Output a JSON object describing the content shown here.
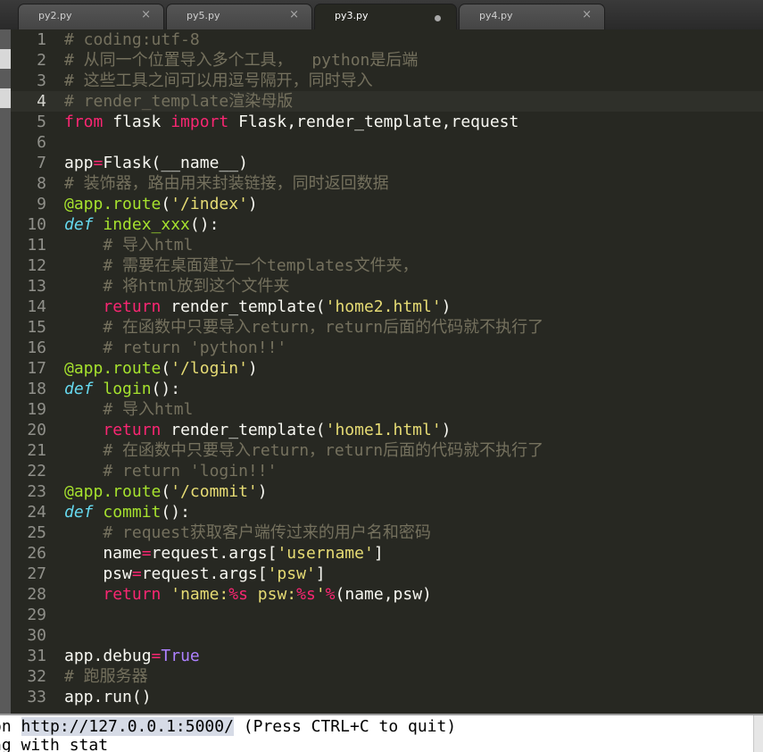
{
  "tabs": [
    {
      "label": "py2.py",
      "close": "×",
      "active": false,
      "dirty": false
    },
    {
      "label": "py5.py",
      "close": "×",
      "active": false,
      "dirty": false
    },
    {
      "label": "py3.py",
      "close": "",
      "active": true,
      "dirty": true
    },
    {
      "label": "py4.py",
      "close": "×",
      "active": false,
      "dirty": false
    }
  ],
  "editor": {
    "current_line": 4,
    "lines": [
      {
        "n": "1",
        "tokens": [
          [
            "c",
            "# coding:utf-8"
          ]
        ]
      },
      {
        "n": "2",
        "tokens": [
          [
            "c",
            "# 从同一个位置导入多个工具，  python是后端"
          ]
        ]
      },
      {
        "n": "3",
        "tokens": [
          [
            "c",
            "# 这些工具之间可以用逗号隔开，同时导入"
          ]
        ]
      },
      {
        "n": "4",
        "tokens": [
          [
            "c",
            "# render_template渲染母版"
          ]
        ]
      },
      {
        "n": "5",
        "tokens": [
          [
            "k",
            "from"
          ],
          [
            "p",
            " flask "
          ],
          [
            "k",
            "import"
          ],
          [
            "p",
            " Flask,render_template,request"
          ]
        ]
      },
      {
        "n": "6",
        "tokens": []
      },
      {
        "n": "7",
        "tokens": [
          [
            "p",
            "app"
          ],
          [
            "o",
            "="
          ],
          [
            "p",
            "Flask(__name__)"
          ]
        ]
      },
      {
        "n": "8",
        "tokens": [
          [
            "c",
            "# 装饰器，路由用来封装链接，同时返回数据"
          ]
        ]
      },
      {
        "n": "9",
        "tokens": [
          [
            "g",
            "@app.route"
          ],
          [
            "p",
            "("
          ],
          [
            "s",
            "'/index'"
          ],
          [
            "p",
            ")"
          ]
        ]
      },
      {
        "n": "10",
        "tokens": [
          [
            "d",
            "def"
          ],
          [
            "p",
            " "
          ],
          [
            "f",
            "index_xxx"
          ],
          [
            "p",
            "():"
          ]
        ]
      },
      {
        "n": "11",
        "tokens": [
          [
            "p",
            "    "
          ],
          [
            "c",
            "# 导入html"
          ]
        ]
      },
      {
        "n": "12",
        "tokens": [
          [
            "p",
            "    "
          ],
          [
            "c",
            "# 需要在桌面建立一个templates文件夹，"
          ]
        ]
      },
      {
        "n": "13",
        "tokens": [
          [
            "p",
            "    "
          ],
          [
            "c",
            "# 将html放到这个文件夹"
          ]
        ]
      },
      {
        "n": "14",
        "tokens": [
          [
            "p",
            "    "
          ],
          [
            "k",
            "return"
          ],
          [
            "p",
            " render_template("
          ],
          [
            "s",
            "'home2.html'"
          ],
          [
            "p",
            ")"
          ]
        ]
      },
      {
        "n": "15",
        "tokens": [
          [
            "p",
            "    "
          ],
          [
            "c",
            "# 在函数中只要导入return，return后面的代码就不执行了"
          ]
        ]
      },
      {
        "n": "16",
        "tokens": [
          [
            "p",
            "    "
          ],
          [
            "c",
            "# return 'python!!'"
          ]
        ]
      },
      {
        "n": "17",
        "tokens": [
          [
            "g",
            "@app.route"
          ],
          [
            "p",
            "("
          ],
          [
            "s",
            "'/login'"
          ],
          [
            "p",
            ")"
          ]
        ]
      },
      {
        "n": "18",
        "tokens": [
          [
            "d",
            "def"
          ],
          [
            "p",
            " "
          ],
          [
            "f",
            "login"
          ],
          [
            "p",
            "():"
          ]
        ]
      },
      {
        "n": "19",
        "tokens": [
          [
            "p",
            "    "
          ],
          [
            "c",
            "# 导入html"
          ]
        ]
      },
      {
        "n": "20",
        "tokens": [
          [
            "p",
            "    "
          ],
          [
            "k",
            "return"
          ],
          [
            "p",
            " render_template("
          ],
          [
            "s",
            "'home1.html'"
          ],
          [
            "p",
            ")"
          ]
        ]
      },
      {
        "n": "21",
        "tokens": [
          [
            "p",
            "    "
          ],
          [
            "c",
            "# 在函数中只要导入return，return后面的代码就不执行了"
          ]
        ]
      },
      {
        "n": "22",
        "tokens": [
          [
            "p",
            "    "
          ],
          [
            "c",
            "# return 'login!!'"
          ]
        ]
      },
      {
        "n": "23",
        "tokens": [
          [
            "g",
            "@app.route"
          ],
          [
            "p",
            "("
          ],
          [
            "s",
            "'/commit'"
          ],
          [
            "p",
            ")"
          ]
        ]
      },
      {
        "n": "24",
        "tokens": [
          [
            "d",
            "def"
          ],
          [
            "p",
            " "
          ],
          [
            "f",
            "commit"
          ],
          [
            "p",
            "():"
          ]
        ]
      },
      {
        "n": "25",
        "tokens": [
          [
            "p",
            "    "
          ],
          [
            "c",
            "# request获取客户端传过来的用户名和密码"
          ]
        ]
      },
      {
        "n": "26",
        "tokens": [
          [
            "p",
            "    name"
          ],
          [
            "o",
            "="
          ],
          [
            "p",
            "request.args["
          ],
          [
            "s",
            "'username'"
          ],
          [
            "p",
            "]"
          ]
        ]
      },
      {
        "n": "27",
        "tokens": [
          [
            "p",
            "    psw"
          ],
          [
            "o",
            "="
          ],
          [
            "p",
            "request.args["
          ],
          [
            "s",
            "'psw'"
          ],
          [
            "p",
            "]"
          ]
        ]
      },
      {
        "n": "28",
        "tokens": [
          [
            "p",
            "    "
          ],
          [
            "k",
            "return"
          ],
          [
            "p",
            " "
          ],
          [
            "s",
            "'name:"
          ],
          [
            "o",
            "%s"
          ],
          [
            "s",
            " psw:"
          ],
          [
            "o",
            "%s"
          ],
          [
            "s",
            "'"
          ],
          [
            "o",
            "%"
          ],
          [
            "p",
            "(name,psw)"
          ]
        ]
      },
      {
        "n": "29",
        "tokens": []
      },
      {
        "n": "30",
        "tokens": []
      },
      {
        "n": "31",
        "tokens": [
          [
            "p",
            "app.debug"
          ],
          [
            "o",
            "="
          ],
          [
            "v",
            "True"
          ]
        ]
      },
      {
        "n": "32",
        "tokens": [
          [
            "c",
            "# 跑服务器"
          ]
        ]
      },
      {
        "n": "33",
        "tokens": [
          [
            "p",
            "app.run()"
          ]
        ]
      }
    ]
  },
  "terminal": {
    "line1_prefix": "on ",
    "line1_url": "http://127.0.0.1:5000/",
    "line1_suffix": " (Press CTRL+C to quit)",
    "line2": "ng with stat"
  },
  "colors": {
    "background": "#272822",
    "comment": "#75715e",
    "keyword": "#f92672",
    "def": "#66d9ef",
    "function": "#a6e22e",
    "string": "#e6db74",
    "constant": "#ae81ff"
  }
}
